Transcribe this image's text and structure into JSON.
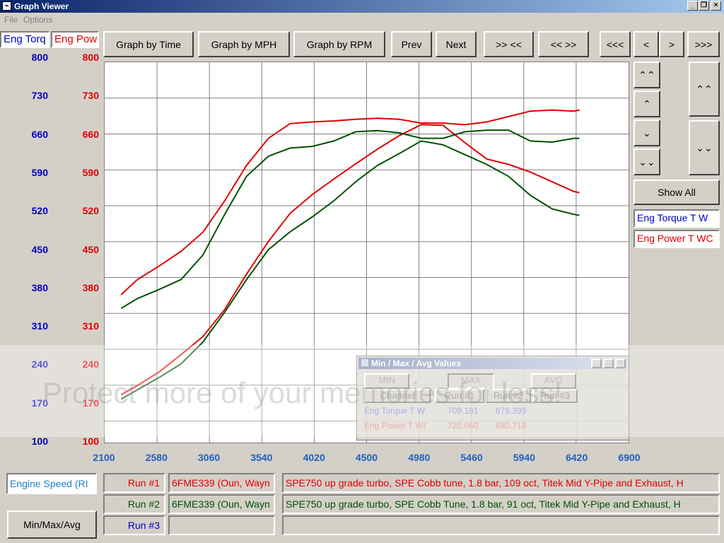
{
  "window": {
    "title": "Graph Viewer"
  },
  "menu": {
    "file": "File",
    "options": "Options"
  },
  "tabs": {
    "torque": "Eng Torq",
    "power": "Eng Powe"
  },
  "toolbar": {
    "by_time": "Graph by Time",
    "by_mph": "Graph by MPH",
    "by_rpm": "Graph by RPM",
    "prev": "Prev",
    "next": "Next",
    "zoom_in": ">> <<",
    "zoom_out": "<< >>",
    "first": "<<<",
    "left": "<",
    "right": ">",
    "last": ">>>"
  },
  "side": {
    "show_all": "Show All",
    "legend_torque": "Eng Torque T W",
    "legend_power": "Eng Power T WC",
    "up_fast": "⌃⌃",
    "up": "⌃",
    "down": "⌄",
    "down_fast": "⌄⌄"
  },
  "bottom": {
    "x_channel": "Engine Speed (RI",
    "minmax_button": "Min/Max/Avg",
    "run1_label": "Run #1",
    "run2_label": "Run #2",
    "run3_label": "Run #3",
    "run1_car": "6FME339 (Oun, Wayn",
    "run2_car": "6FME339 (Oun, Wayn",
    "run1_desc": "SPE750 up grade turbo, SPE Cobb tune, 1.8 bar, 109 oct, Titek Mid Y-Pipe and Exhaust, H",
    "run2_desc": "SPE750 up grade turbo, SPE Cobb Tune, 1.8 bar, 91 oct, Titek Mid Y-Pipe and Exhaust, H"
  },
  "minmax": {
    "title": "Min / Max / Avg Values",
    "min": "MIN",
    "max": "MAX",
    "avg": "AVG",
    "col_channel": "Channel",
    "col_run1": "Run #1",
    "col_run2": "Run #2",
    "col_run3": "Run #3",
    "rows": [
      {
        "name": "Eng Torque T W",
        "run1": "709.181",
        "run2": "676.399"
      },
      {
        "name": "Eng Power T W(",
        "run1": "720.660",
        "run2": "680.718"
      }
    ]
  },
  "watermark": "Protect more of your memories for less!",
  "colors": {
    "torque_axis": "#0000c0",
    "power_axis": "#e00000",
    "run1": "#e00000",
    "run2": "#005000"
  },
  "chart_data": {
    "type": "line",
    "xlabel": "",
    "x_ticks": [
      "2100",
      "2580",
      "3060",
      "3540",
      "4020",
      "4500",
      "4980",
      "5460",
      "5940",
      "6420",
      "6900"
    ],
    "xlim": [
      2100,
      6900
    ],
    "y_left_ticks": [
      "800",
      "730",
      "660",
      "590",
      "520",
      "450",
      "380",
      "310",
      "240",
      "170",
      "100"
    ],
    "y_right_ticks": [
      "800",
      "730",
      "660",
      "590",
      "520",
      "450",
      "380",
      "310",
      "240",
      "170",
      "100"
    ],
    "ylim": [
      100,
      800
    ],
    "grid": true,
    "series": [
      {
        "name": "Run #1",
        "channel": "Eng Power T W",
        "color": "#e00000",
        "x": [
          2250,
          2400,
          2600,
          2800,
          3000,
          3200,
          3400,
          3600,
          3800,
          4000,
          4200,
          4400,
          4600,
          4800,
          5000,
          5200,
          5400,
          5600,
          5800,
          6000,
          6200,
          6400,
          6450
        ],
        "y": [
          372,
          400,
          425,
          452,
          487,
          545,
          610,
          660,
          687,
          690,
          692,
          695,
          697,
          695,
          688,
          688,
          685,
          690,
          700,
          710,
          712,
          710,
          712
        ]
      },
      {
        "name": "Run #1",
        "channel": "Eng Torque T W",
        "color": "#e00000",
        "x": [
          2250,
          2400,
          2600,
          2800,
          3000,
          3200,
          3400,
          3600,
          3800,
          4000,
          4200,
          4400,
          4600,
          4800,
          5000,
          5200,
          5400,
          5600,
          5800,
          6000,
          6200,
          6400,
          6450
        ],
        "y": [
          188,
          205,
          230,
          262,
          295,
          345,
          410,
          470,
          522,
          556,
          585,
          613,
          640,
          665,
          685,
          684,
          652,
          622,
          612,
          598,
          580,
          562,
          560
        ]
      },
      {
        "name": "Run #2",
        "channel": "Eng Torque T W",
        "color": "#005000",
        "x": [
          2250,
          2400,
          2600,
          2800,
          3000,
          3200,
          3400,
          3600,
          3800,
          4000,
          4200,
          4400,
          4600,
          4800,
          5000,
          5200,
          5400,
          5600,
          5800,
          6000,
          6200,
          6400,
          6450
        ],
        "y": [
          347,
          365,
          382,
          400,
          445,
          520,
          590,
          627,
          642,
          645,
          655,
          672,
          674,
          670,
          660,
          660,
          672,
          675,
          675,
          655,
          653,
          660,
          660
        ]
      },
      {
        "name": "Run #2",
        "channel": "Eng Power T W",
        "color": "#005000",
        "x": [
          2250,
          2400,
          2600,
          2800,
          3000,
          3200,
          3400,
          3600,
          3800,
          4000,
          4200,
          4400,
          4600,
          4800,
          5000,
          5200,
          5400,
          5600,
          5800,
          6000,
          6200,
          6400,
          6450
        ],
        "y": [
          180,
          197,
          220,
          245,
          285,
          340,
          400,
          455,
          488,
          515,
          545,
          580,
          610,
          632,
          655,
          648,
          630,
          612,
          590,
          555,
          530,
          520,
          518
        ]
      }
    ]
  }
}
